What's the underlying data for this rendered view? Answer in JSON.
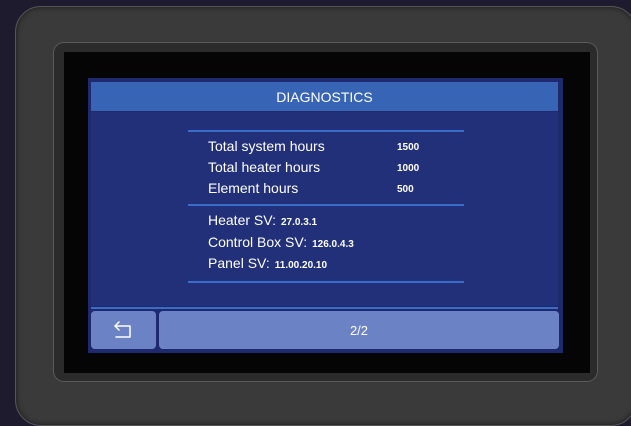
{
  "title": "DIAGNOSTICS",
  "stats": [
    {
      "label": "Total system hours",
      "value": "1500"
    },
    {
      "label": "Total heater hours",
      "value": "1000"
    },
    {
      "label": "Element hours",
      "value": "500"
    }
  ],
  "versions": [
    {
      "label": "Heater SV:",
      "value": "27.0.3.1"
    },
    {
      "label": "Control Box SV:",
      "value": "126.0.4.3"
    },
    {
      "label": "Panel SV:",
      "value": "11.00.20.10"
    }
  ],
  "footer": {
    "back_icon": "return-arrow-icon",
    "page": "2/2"
  },
  "colors": {
    "title_bar": "#3764b5",
    "panel": "#22307a",
    "button": "#6b83c4",
    "divider": "#3a6dc8"
  }
}
